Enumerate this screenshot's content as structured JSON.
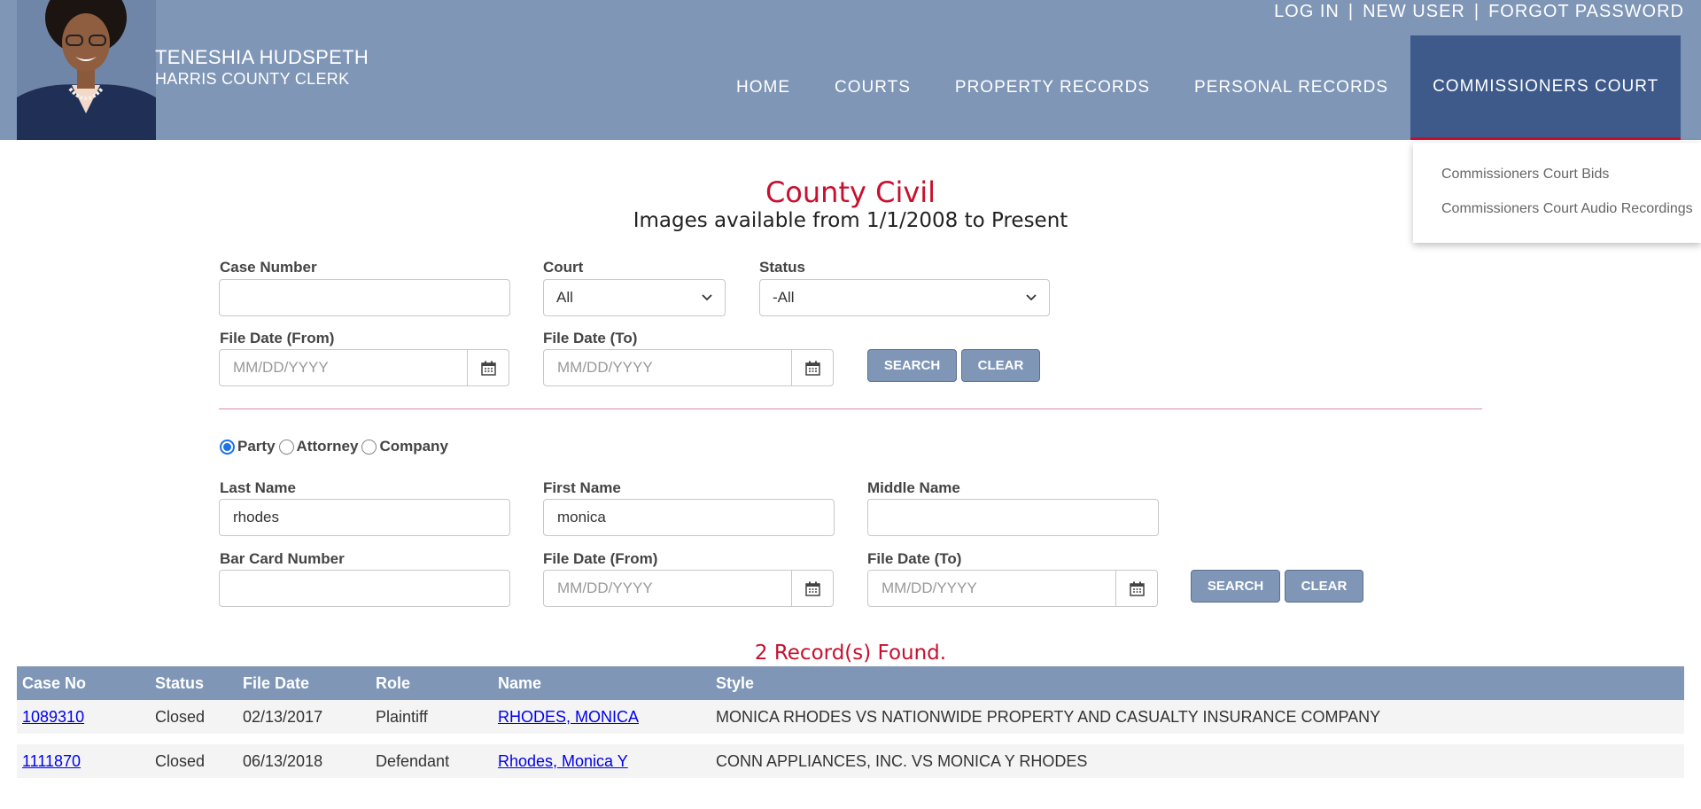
{
  "header": {
    "clerk_name": "TENESHIA HUDSPETH",
    "clerk_title": "HARRIS COUNTY CLERK",
    "account_links": [
      "LOG IN",
      "NEW USER",
      "FORGOT PASSWORD"
    ],
    "nav": [
      "HOME",
      "COURTS",
      "PROPERTY RECORDS",
      "PERSONAL RECORDS",
      "COMMISSIONERS COURT"
    ],
    "active_nav": "COMMISSIONERS COURT"
  },
  "dropdown": {
    "items": [
      "Commissioners Court Bids",
      "Commissioners Court Audio Recordings"
    ]
  },
  "page": {
    "title": "County Civil",
    "subtitle": "Images available from 1/1/2008 to Present"
  },
  "case_search": {
    "case_number_label": "Case Number",
    "case_number_value": "",
    "court_label": "Court",
    "court_value": "All",
    "status_label": "Status",
    "status_value": "-All",
    "date_from_label": "File Date (From)",
    "date_to_label": "File Date (To)",
    "date_placeholder": "MM/DD/YYYY",
    "search_label": "SEARCH",
    "clear_label": "CLEAR"
  },
  "party_search": {
    "types": [
      "Party",
      "Attorney",
      "Company"
    ],
    "selected_type": "Party",
    "last_name_label": "Last Name",
    "last_name_value": "rhodes",
    "first_name_label": "First Name",
    "first_name_value": "monica",
    "middle_name_label": "Middle Name",
    "middle_name_value": "",
    "bar_card_label": "Bar Card Number",
    "bar_card_value": "",
    "date_from_label": "File Date (From)",
    "date_to_label": "File Date (To)",
    "date_placeholder": "MM/DD/YYYY",
    "search_label": "SEARCH",
    "clear_label": "CLEAR"
  },
  "results": {
    "count_text": "2 Record(s) Found.",
    "columns": [
      "Case No",
      "Status",
      "File Date",
      "Role",
      "Name",
      "Style"
    ],
    "rows": [
      {
        "case_no": "1089310",
        "status": "Closed",
        "file_date": "02/13/2017",
        "role": "Plaintiff",
        "name": "RHODES, MONICA",
        "style": "MONICA RHODES VS NATIONWIDE PROPERTY AND CASUALTY INSURANCE COMPANY"
      },
      {
        "case_no": "1111870",
        "status": "Closed",
        "file_date": "06/13/2018",
        "role": "Defendant",
        "name": "Rhodes, Monica Y",
        "style": "CONN APPLIANCES, INC. VS MONICA Y RHODES"
      }
    ]
  },
  "colors": {
    "header_bg": "#7f96b7",
    "active_nav_bg": "#3d5a8b",
    "accent_red": "#c8102e",
    "link_blue": "#0000ee"
  },
  "icons": {
    "calendar": "calendar-icon",
    "chevron": "chevron-down-icon"
  }
}
